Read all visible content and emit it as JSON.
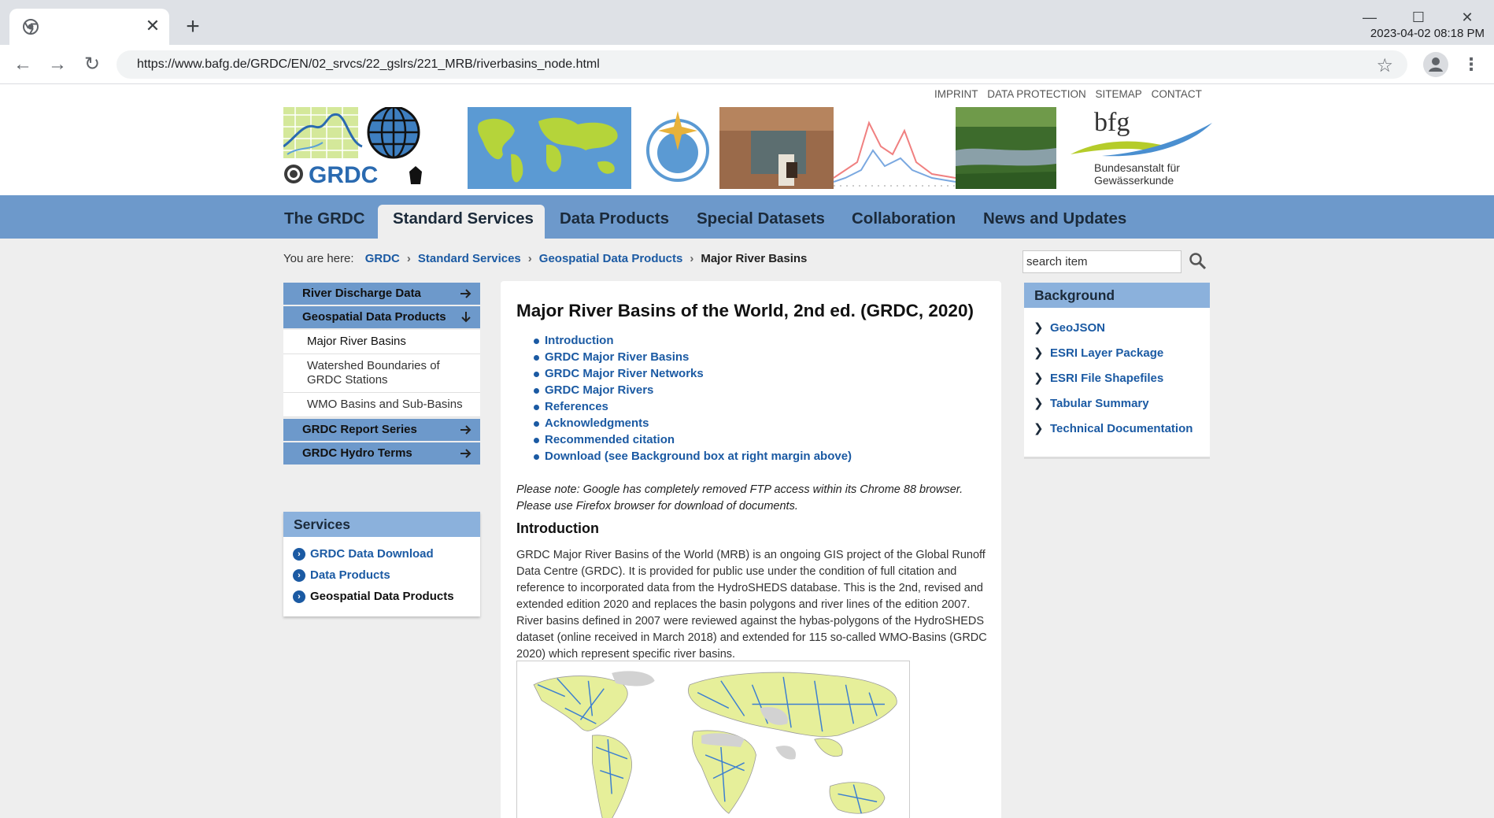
{
  "browser": {
    "tab_title": "",
    "tab_close_icon": "close-icon",
    "new_tab_icon": "plus-icon",
    "url": "https://www.bafg.de/GRDC/EN/02_srvcs/22_gslrs/221_MRB/riverbasins_node.html",
    "clock": "2023-04-02 08:18 PM"
  },
  "header": {
    "top_links": [
      "IMPRINT",
      "DATA PROTECTION",
      "SITEMAP",
      "CONTACT"
    ],
    "logo_grdc_text": "GRDC",
    "logo_bfg_text": "bfg",
    "logo_bfg_sub1": "Bundesanstalt für",
    "logo_bfg_sub2": "Gewässerkunde"
  },
  "mainnav": {
    "items": [
      "The GRDC",
      "Standard Services",
      "Data Products",
      "Special Datasets",
      "Collaboration",
      "News and Updates"
    ],
    "active": "Standard Services"
  },
  "breadcrumb": {
    "prefix": "You are here:",
    "links": [
      "GRDC",
      "Standard Services",
      "Geospatial Data Products"
    ],
    "current": "Major River Basins"
  },
  "search": {
    "value": "search item"
  },
  "leftnav": {
    "items": [
      {
        "label": "River Discharge Data"
      },
      {
        "label": "Geospatial Data Products"
      },
      {
        "label": "GRDC Report Series"
      },
      {
        "label": "GRDC Hydro Terms"
      }
    ],
    "subitems": [
      "Major River Basins",
      "Watershed Boundaries of GRDC Stations",
      "WMO Basins and Sub-Basins"
    ]
  },
  "services": {
    "title": "Services",
    "items": [
      "GRDC Data Download",
      "Data Products",
      "Geospatial Data Products"
    ]
  },
  "content": {
    "title": "Major River Basins of the World, 2nd ed. (GRDC, 2020)",
    "toc": [
      "Introduction",
      "GRDC Major River Basins",
      "GRDC Major River Networks",
      "GRDC Major Rivers",
      "References",
      "Acknowledgments",
      "Recommended citation",
      "Download (see Background box at right margin above)"
    ],
    "note": "Please note: Google has completely removed FTP access within its Chrome 88 browser. Please use Firefox browser for download of documents.",
    "intro_heading": "Introduction",
    "intro_text": "GRDC Major River Basins of the World (MRB) is an ongoing GIS project of the Global Runoff Data Centre (GRDC). It is provided for public use under the condition of full citation and reference to incorporated data from the HydroSHEDS database. This is the 2nd, revised and extended edition 2020 and replaces the basin polygons and river lines of the edition 2007. River basins defined in 2007 were reviewed against the hybas-polygons of the HydroSHEDS dataset (online received in March 2018) and extended for 115 so-called WMO-Basins (GRDC 2020) which represent specific river basins."
  },
  "background": {
    "title": "Background",
    "items": [
      "GeoJSON",
      "ESRI Layer Package",
      "ESRI File Shapefiles",
      "Tabular Summary",
      "Technical Documentation"
    ]
  },
  "colors": {
    "nav_blue": "#6d99cb",
    "box_head_blue": "#8bb1dc",
    "link_blue": "#1b5aa3",
    "page_bg": "#eeeeee"
  }
}
